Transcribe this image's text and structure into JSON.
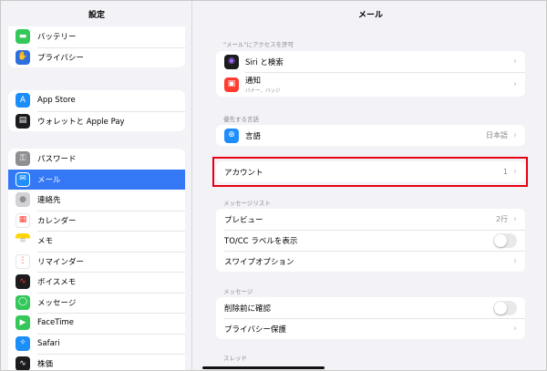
{
  "sidebar": {
    "title": "設定",
    "groups": [
      [
        {
          "label": "バッテリー",
          "icon": "battery-icon",
          "color": "#34c759",
          "glyph": "▬"
        },
        {
          "label": "プライバシー",
          "icon": "hand-icon",
          "color": "#2e6fe0",
          "glyph": "✋"
        }
      ],
      [
        {
          "label": "App Store",
          "icon": "app-store-icon",
          "color": "#1c8ef9",
          "glyph": "A"
        },
        {
          "label": "ウォレットと Apple Pay",
          "icon": "wallet-icon",
          "color": "#1c1c1e",
          "glyph": "▤"
        }
      ],
      [
        {
          "label": "パスワード",
          "icon": "key-icon",
          "color": "#8e8e93",
          "glyph": "⚿"
        },
        {
          "label": "メール",
          "icon": "mail-icon",
          "color": "#1f8efa",
          "glyph": "✉"
        },
        {
          "label": "連絡先",
          "icon": "contacts-icon",
          "color": "#b8b8bd",
          "glyph": "●"
        },
        {
          "label": "カレンダー",
          "icon": "calendar-icon",
          "color": "#ffffff",
          "glyph": "▦"
        },
        {
          "label": "メモ",
          "icon": "notes-icon",
          "color": "#ffd60a",
          "glyph": "≡"
        },
        {
          "label": "リマインダー",
          "icon": "reminders-icon",
          "color": "#ffffff",
          "glyph": "⋮"
        },
        {
          "label": "ボイスメモ",
          "icon": "voice-memo-icon",
          "color": "#1c1c1e",
          "glyph": "∿"
        },
        {
          "label": "メッセージ",
          "icon": "messages-icon",
          "color": "#34c759",
          "glyph": "◯"
        },
        {
          "label": "FaceTime",
          "icon": "facetime-icon",
          "color": "#34c759",
          "glyph": "▶"
        },
        {
          "label": "Safari",
          "icon": "safari-icon",
          "color": "#1c8ef9",
          "glyph": "✧"
        },
        {
          "label": "株価",
          "icon": "stocks-icon",
          "color": "#1c1c1e",
          "glyph": "∿"
        }
      ]
    ],
    "selected": "メール"
  },
  "main": {
    "title": "メール",
    "access": {
      "header": "\"メール\"にアクセスを許可",
      "siri": {
        "label": "Siri と検索",
        "icon": "siri-icon",
        "color": "#1c1c1e",
        "glyph": "◉"
      },
      "notifications": {
        "label": "通知",
        "sub": "バナー、バッジ",
        "icon": "notification-icon",
        "color": "#ff3b30",
        "glyph": "▣"
      }
    },
    "language": {
      "header": "優先する言語",
      "row": {
        "label": "言語",
        "value": "日本語",
        "icon": "globe-icon",
        "color": "#1f8efa",
        "glyph": "⊕"
      }
    },
    "accounts": {
      "label": "アカウント",
      "value": "1"
    },
    "message_list": {
      "header": "メッセージリスト",
      "preview": {
        "label": "プレビュー",
        "value": "2行"
      },
      "to_cc": {
        "label": "TO/CC ラベルを表示"
      },
      "swipe": {
        "label": "スワイプオプション"
      }
    },
    "messages": {
      "header": "メッセージ",
      "ask_delete": {
        "label": "削除前に確認"
      },
      "privacy": {
        "label": "プライバシー保護"
      }
    },
    "thread_header": "スレッド",
    "chevron": "›",
    "highlight_color": "#e60012",
    "accent_color": "#3478f6"
  }
}
